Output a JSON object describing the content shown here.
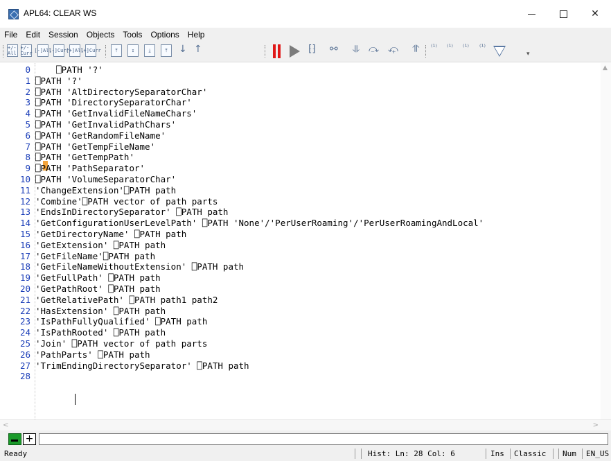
{
  "window": {
    "title": "APL64: CLEAR WS",
    "minimize": "—",
    "close": "✕"
  },
  "menu": [
    "File",
    "Edit",
    "Session",
    "Objects",
    "Tools",
    "Options",
    "Help"
  ],
  "toolbar": {
    "format_buttons": [
      "+/-All",
      "+/-Curr",
      "[-]All",
      "[-]Curr",
      "[+]All",
      "[+]Curr"
    ],
    "nav_buttons": [
      "⤒",
      "↧",
      "⤓",
      "⤒",
      "↓",
      "↑"
    ],
    "debug_icons": [
      "trace-icon",
      "pause-icon",
      "run-icon",
      "bracket-swap-icon",
      "bike-icon",
      "step-into-icon",
      "step-over-icon",
      "step-back-icon",
      "step-out-icon",
      "bracket-1-2-icon",
      "bracket-right-icon",
      "bracket-down-icon",
      "bracket-cursor-icon",
      "triangle-down-icon"
    ]
  },
  "editor": {
    "lines": [
      {
        "n": "0",
        "text": "    ⎕PATH '?'"
      },
      {
        "n": "1",
        "text": "⎕PATH '?'"
      },
      {
        "n": "2",
        "text": "⎕PATH 'AltDirectorySeparatorChar'"
      },
      {
        "n": "3",
        "text": "⎕PATH 'DirectorySeparatorChar'"
      },
      {
        "n": "4",
        "text": "⎕PATH 'GetInvalidFileNameChars'"
      },
      {
        "n": "5",
        "text": "⎕PATH 'GetInvalidPathChars'"
      },
      {
        "n": "6",
        "text": "⎕PATH 'GetRandomFileName'"
      },
      {
        "n": "7",
        "text": "⎕PATH 'GetTempFileName'"
      },
      {
        "n": "8",
        "text": "⎕PATH 'GetTempPath'"
      },
      {
        "n": "9",
        "text": "⎕PATH 'PathSeparator'"
      },
      {
        "n": "10",
        "text": "⎕PATH 'VolumeSeparatorChar'"
      },
      {
        "n": "11",
        "text": "'ChangeExtension'⎕PATH path"
      },
      {
        "n": "12",
        "text": "'Combine'⎕PATH vector of path parts"
      },
      {
        "n": "13",
        "text": "'EndsInDirectorySeparator' ⎕PATH path"
      },
      {
        "n": "14",
        "text": "'GetConfigurationUserLevelPath' ⎕PATH 'None'/'PerUserRoaming'/'PerUserRoamingAndLocal'"
      },
      {
        "n": "15",
        "text": "'GetDirectoryName' ⎕PATH path"
      },
      {
        "n": "16",
        "text": "'GetExtension' ⎕PATH path"
      },
      {
        "n": "17",
        "text": "'GetFileName'⎕PATH path"
      },
      {
        "n": "18",
        "text": "'GetFileNameWithoutExtension' ⎕PATH path"
      },
      {
        "n": "19",
        "text": "'GetFullPath' ⎕PATH path"
      },
      {
        "n": "20",
        "text": "'GetPathRoot' ⎕PATH path"
      },
      {
        "n": "21",
        "text": "'GetRelativePath' ⎕PATH path1 path2"
      },
      {
        "n": "22",
        "text": "'HasExtension' ⎕PATH path"
      },
      {
        "n": "23",
        "text": "'IsPathFullyQualified' ⎕PATH path"
      },
      {
        "n": "24",
        "text": "'IsPathRooted' ⎕PATH path"
      },
      {
        "n": "25",
        "text": "'Join' ⎕PATH vector of path parts"
      },
      {
        "n": "26",
        "text": "'PathParts' ⎕PATH path"
      },
      {
        "n": "27",
        "text": "'TrimEndingDirectorySeparator' ⎕PATH path"
      },
      {
        "n": "28",
        "text": ""
      }
    ]
  },
  "session_tabs": {
    "add_label": "+"
  },
  "status": {
    "ready": "Ready",
    "hist": "Hist: Ln: 28 Col: 6",
    "ins": "Ins",
    "mode": "Classic",
    "num": "Num",
    "locale": "EN_US"
  }
}
